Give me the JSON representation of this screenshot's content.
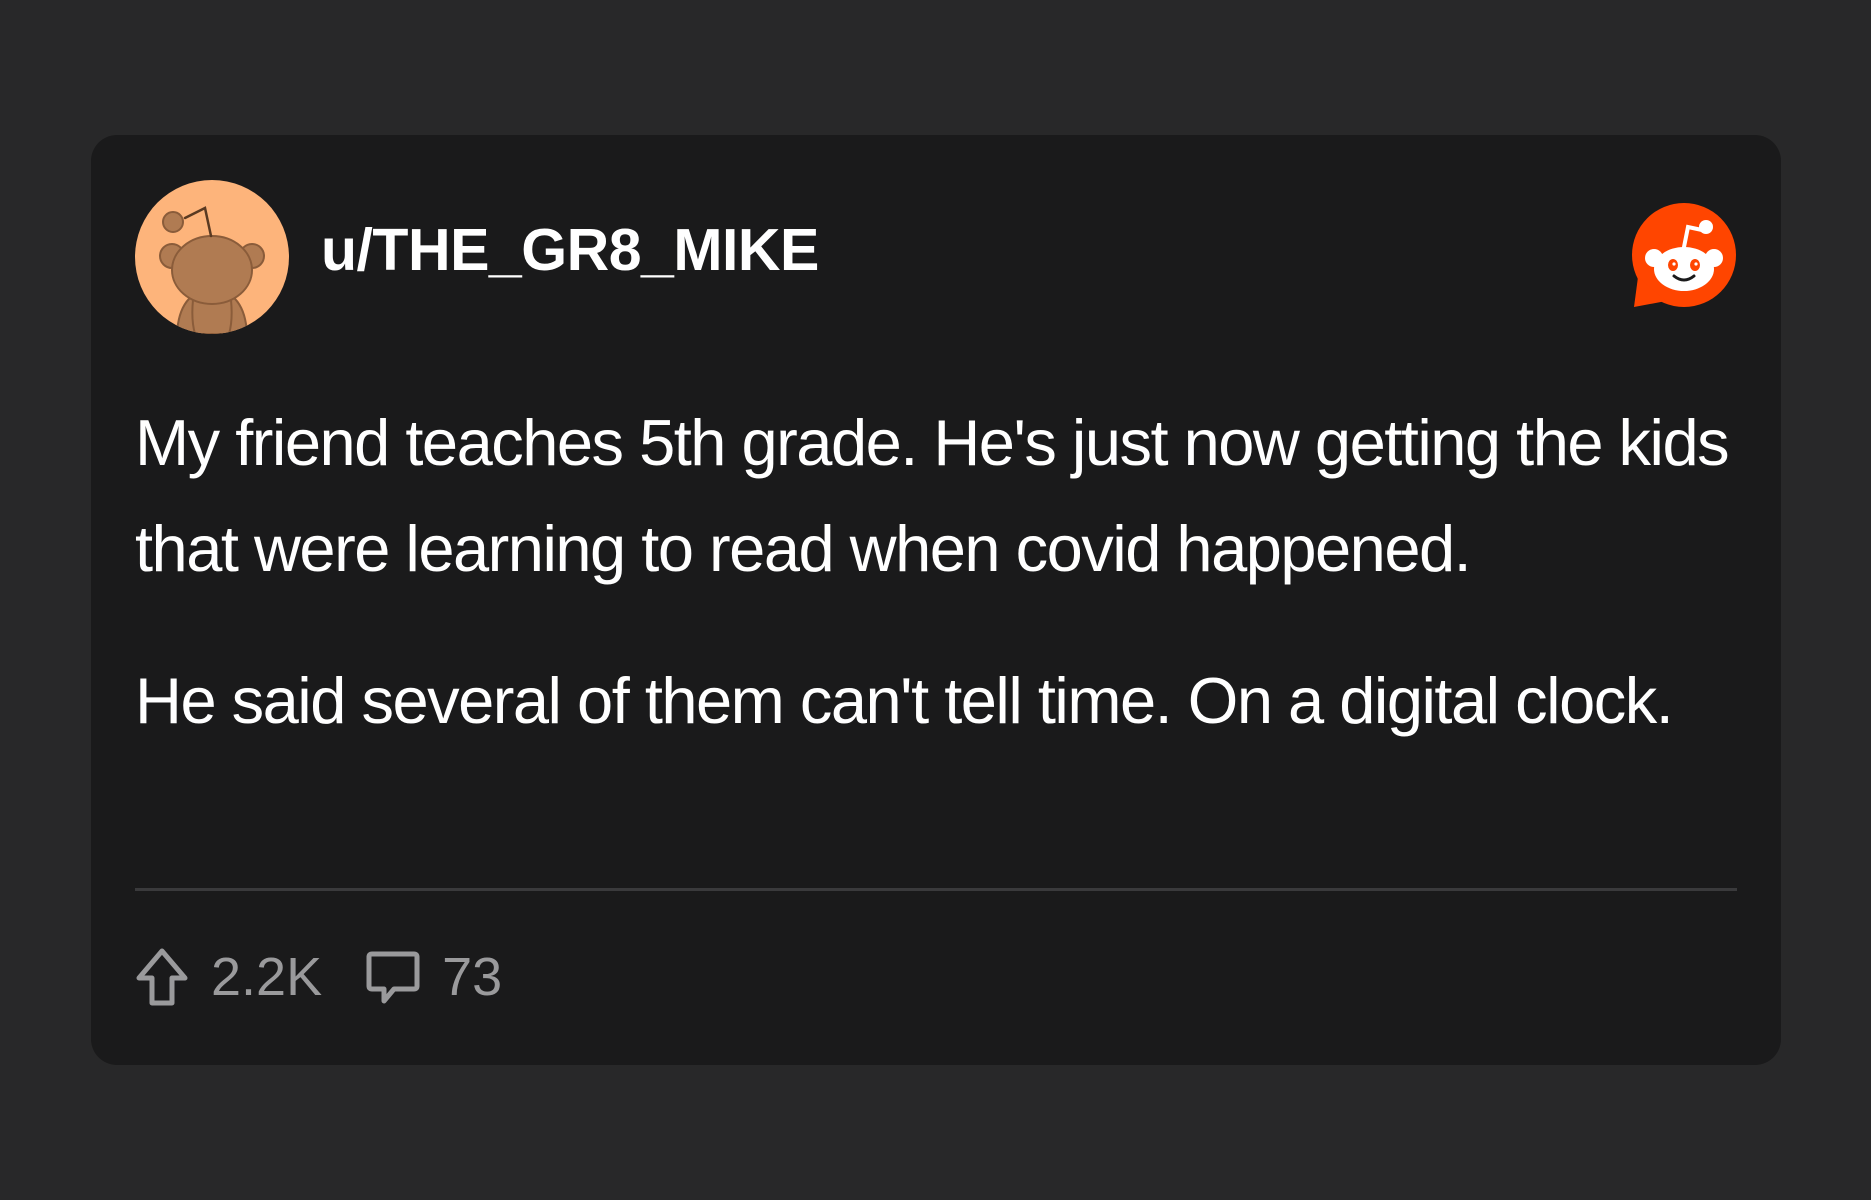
{
  "post": {
    "username": "u/THE_GR8_MIKE",
    "paragraphs": [
      "My friend teaches 5th grade. He's just now getting the kids that were learning to read when covid happened.",
      "He said several of them can't tell time. On a digital clock."
    ],
    "upvotes": "2.2K",
    "comments": "73"
  },
  "icons": {
    "avatar": "snoo-avatar-icon",
    "logo": "reddit-logo-icon",
    "upvote": "upvote-arrow-icon",
    "comment": "comment-bubble-icon"
  },
  "colors": {
    "page_background": "#282829",
    "card_background": "#1a1a1b",
    "avatar_background": "#fdb47b",
    "reddit_orange": "#ff4500",
    "text_primary": "#ffffff",
    "text_secondary": "#9a9a9c"
  }
}
